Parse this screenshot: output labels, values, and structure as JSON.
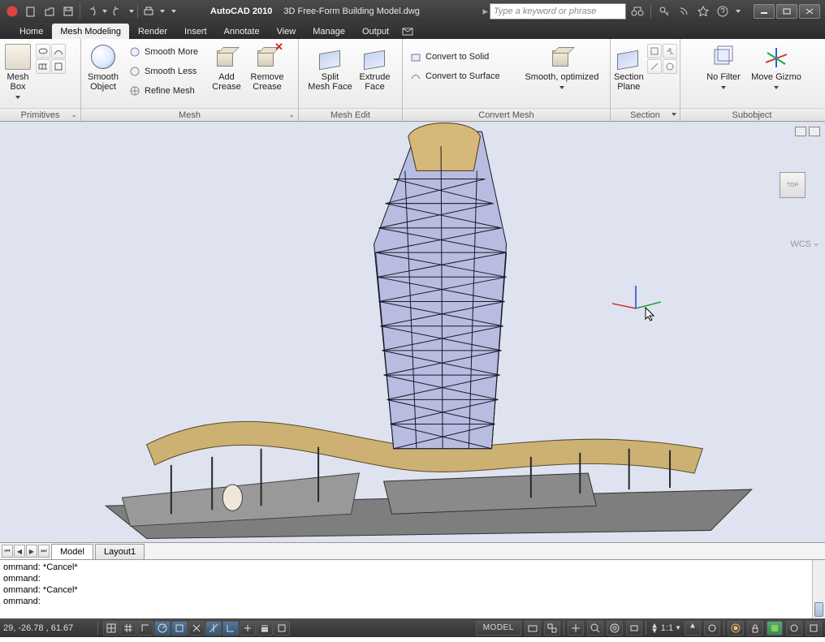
{
  "title": {
    "product": "AutoCAD 2010",
    "file": "3D Free-Form Building Model.dwg"
  },
  "search": {
    "placeholder": "Type a keyword or phrase"
  },
  "tabs": [
    "Home",
    "Mesh Modeling",
    "Render",
    "Insert",
    "Annotate",
    "View",
    "Manage",
    "Output"
  ],
  "active_tab": "Mesh Modeling",
  "ribbon": {
    "primitives": {
      "title": "Primitives",
      "mesh_box": "Mesh Box"
    },
    "mesh": {
      "title": "Mesh",
      "smooth_object": "Smooth\nObject",
      "smooth_more": "Smooth More",
      "smooth_less": "Smooth Less",
      "refine_mesh": "Refine Mesh",
      "add_crease": "Add\nCrease",
      "remove_crease": "Remove\nCrease"
    },
    "mesh_edit": {
      "title": "Mesh Edit",
      "split_face": "Split\nMesh Face",
      "extrude_face": "Extrude\nFace"
    },
    "convert": {
      "title": "Convert Mesh",
      "to_solid": "Convert to Solid",
      "to_surface": "Convert to Surface",
      "smooth_opt": "Smooth, optimized"
    },
    "section": {
      "title": "Section",
      "section_plane": "Section\nPlane"
    },
    "subobject": {
      "title": "Subobject",
      "no_filter": "No Filter",
      "move_gizmo": "Move Gizmo"
    }
  },
  "viewport": {
    "wcs": "WCS"
  },
  "viewcube": {
    "label": "TOP"
  },
  "sheet_tabs": [
    "Model",
    "Layout1"
  ],
  "command_lines": [
    "ommand: *Cancel*",
    "ommand:",
    "ommand: *Cancel*",
    "ommand:"
  ],
  "status": {
    "coords": "29,  -26.78 , 61.67",
    "model_btn": "MODEL",
    "scale": "1:1"
  }
}
